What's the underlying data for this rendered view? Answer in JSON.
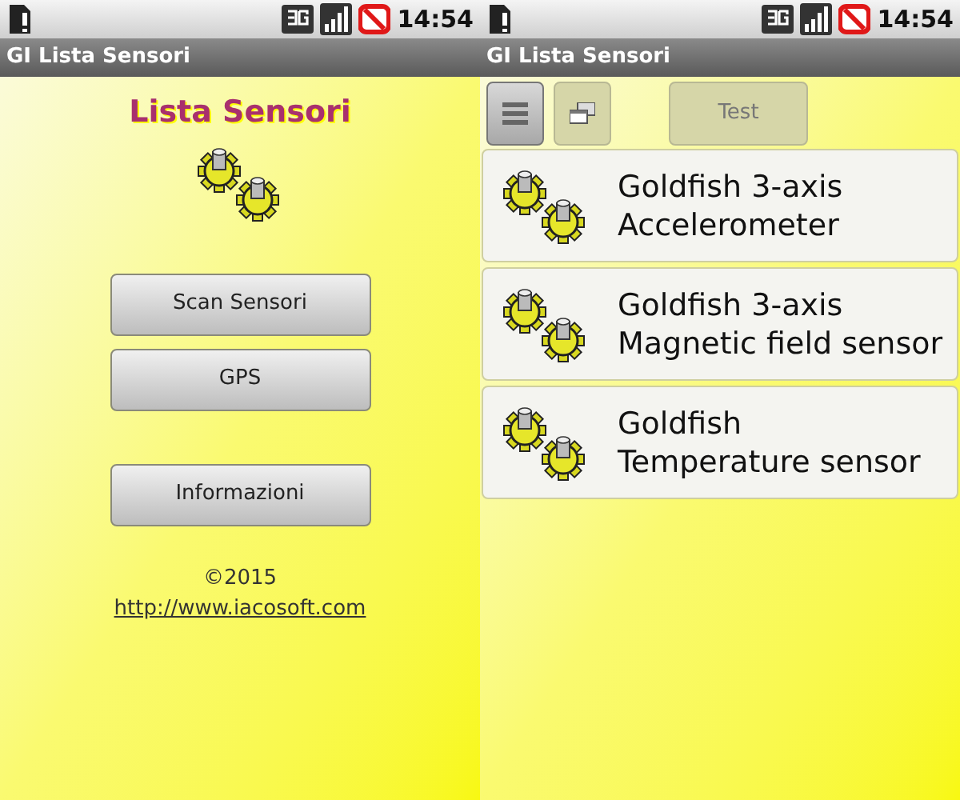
{
  "screens": [
    {
      "status_bar": {
        "time": "14:54"
      },
      "title_bar": {
        "title": "GI Lista Sensori"
      },
      "main": {
        "heading": "Lista Sensori",
        "buttons": [
          "Scan Sensori",
          "GPS"
        ],
        "info_button": "Informazioni",
        "copyright": "©2015",
        "link": "http://www.iacosoft.com"
      }
    },
    {
      "status_bar": {
        "time": "14:54"
      },
      "title_bar": {
        "title": "GI Lista Sensori"
      },
      "toolbar": [
        {
          "kind": "list",
          "selected": true
        },
        {
          "kind": "window",
          "selected": false
        },
        {
          "kind": "text",
          "label": "Test",
          "selected": false
        }
      ],
      "sensors": [
        {
          "line_1": "Goldfish 3-axis",
          "line_2": "Accelerometer"
        },
        {
          "line_1": "Goldfish 3-axis",
          "line_2": "Magnetic field sensor"
        },
        {
          "line_1": "Goldfish",
          "line_2": "Temperature sensor"
        }
      ]
    }
  ]
}
